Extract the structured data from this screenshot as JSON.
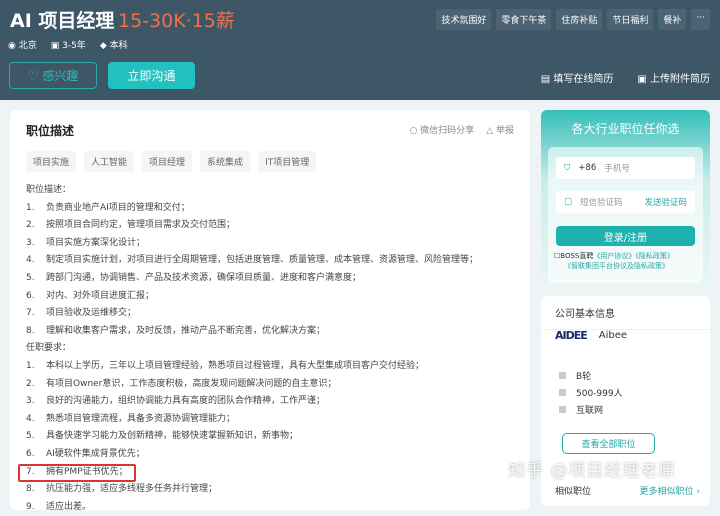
{
  "header": {
    "title": "AI 项目经理",
    "salary": "15-30K·15薪",
    "welfare": [
      "技术氛围好",
      "零食下午茶",
      "住房补贴",
      "节日福利",
      "餐补",
      "···"
    ],
    "location": "北京",
    "experience": "3-5年",
    "degree": "本科",
    "interest_label": "感兴趣",
    "chat_label": "立即沟通",
    "fill_resume": "填写在线简历",
    "upload_resume": "上传附件简历"
  },
  "job": {
    "section_title": "职位描述",
    "share": "微信扫码分享",
    "report": "举报",
    "tags": [
      "项目实施",
      "人工智能",
      "项目经理",
      "系统集成",
      "IT项目管理"
    ],
    "desc_heading": "职位描述：",
    "duties": [
      "负责商业地产AI项目的管理和交付；",
      "按照项目合同约定，管理项目需求及交付范围；",
      "项目实施方案深化设计；",
      "制定项目实施计划，对项目进行全周期管理，包括进度管理、质量管理、成本管理、资源管理、风险管理等；",
      "跨部门沟通，协调销售、产品及技术资源，确保项目质量、进度和客户满意度；",
      "对内、对外项目进度汇报；",
      "项目验收及运维移交；",
      "理解和收集客户需求，及时反馈，推动产品不断完善，优化解决方案；"
    ],
    "req_heading": "任职要求：",
    "requirements": [
      "本科以上学历，三年以上项目管理经验，熟悉项目过程管理，具有大型集成项目客户交付经验；",
      "有项目Owner意识，工作态度积极，高度发现问题解决问题的自主意识；",
      "良好的沟通能力，组织协调能力具有高度的团队合作精神，工作严谨；",
      "熟悉项目管理流程，具备多资源协调管理能力；",
      "具备快速学习能力及创新精神，能够快速掌握新知识，新事物；",
      "AI硬软件集成背景优先；",
      "拥有PMP证书优先；",
      "抗压能力强，适应多线程多任务并行管理；",
      "适应出差。"
    ]
  },
  "login": {
    "title": "各大行业职位任你选",
    "country_code": "+86",
    "phone_placeholder": "手机号",
    "code_placeholder": "短信验证码",
    "send_code": "发送验证码",
    "submit": "登录/注册",
    "agree_prefix": "BOSS直聘",
    "user_agreement": "《用户协议》",
    "privacy": "《隐私政策》",
    "group_agreement": "《智联集团平台协议及隐私政策》"
  },
  "company": {
    "section_title": "公司基本信息",
    "logo_text": "AIDEE",
    "name": "Aibee",
    "stage": "B轮",
    "size": "500-999人",
    "industry": "互联网",
    "view_all": "查看全部职位",
    "similar": "相似职位",
    "more_similar": "更多相似职位 ›"
  },
  "watermark": "知乎 @项目经理老原"
}
